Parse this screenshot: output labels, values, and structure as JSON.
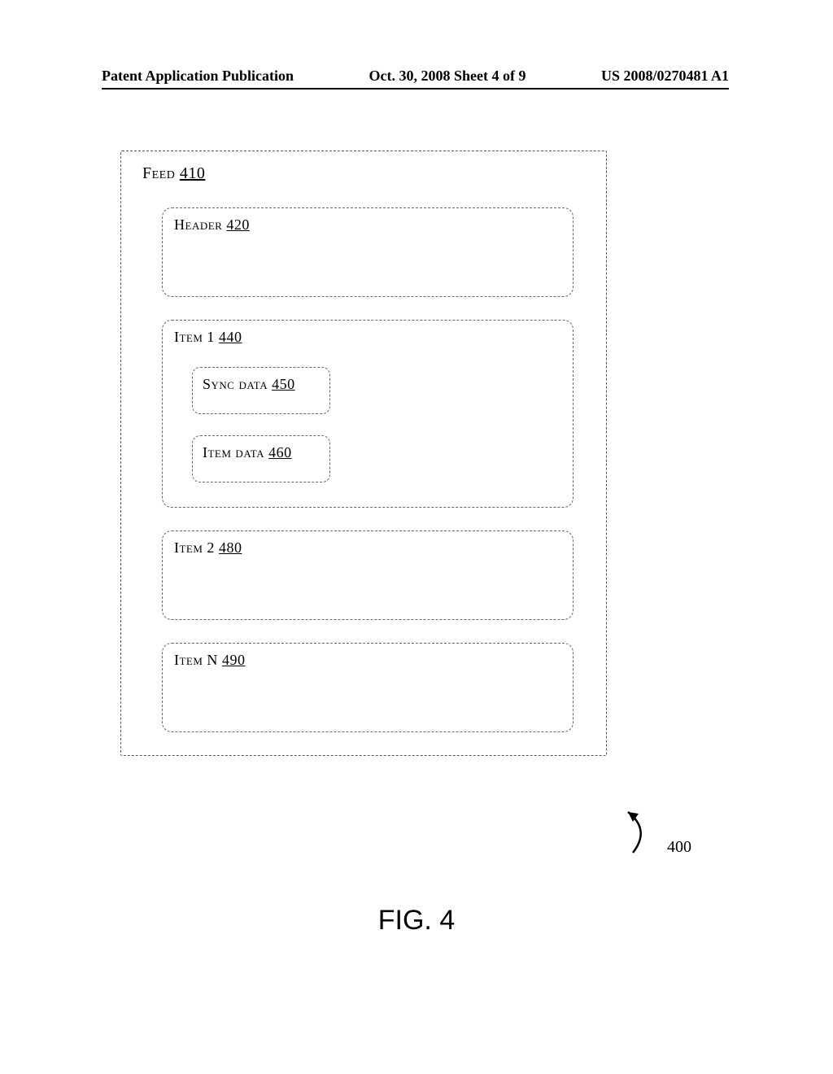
{
  "header": {
    "left": "Patent Application Publication",
    "center": "Oct. 30, 2008  Sheet 4 of 9",
    "right": "US 2008/0270481 A1"
  },
  "feed": {
    "label": "Feed",
    "ref": "410"
  },
  "boxes": {
    "header": {
      "label": "Header",
      "ref": "420"
    },
    "item1": {
      "label": "Item 1",
      "ref": "440"
    },
    "sync": {
      "label": "Sync data",
      "ref": "450"
    },
    "itemdata": {
      "label": "Item data",
      "ref": "460"
    },
    "item2": {
      "label": "Item 2",
      "ref": "480"
    },
    "itemn": {
      "label": "Item N",
      "ref": "490"
    }
  },
  "callout_ref": "400",
  "figure_label": "FIG. 4"
}
